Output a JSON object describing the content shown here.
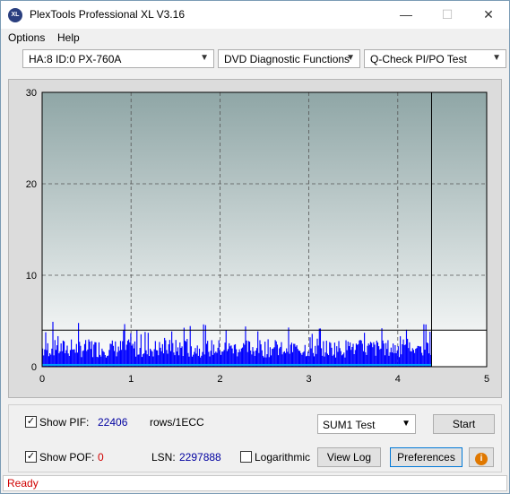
{
  "window": {
    "title": "PlexTools Professional XL V3.16",
    "app_icon": "XL"
  },
  "menu": {
    "options": "Options",
    "help": "Help"
  },
  "toolbar": {
    "drive": "HA:8 ID:0  PX-760A",
    "function": "DVD Diagnostic Functions",
    "test": "Q-Check PI/PO Test"
  },
  "chart_data": {
    "type": "bar",
    "x_ticks": [
      "0",
      "1",
      "2",
      "3",
      "4",
      "5"
    ],
    "y_ticks": [
      "0",
      "10",
      "20",
      "30"
    ],
    "xlim": [
      0,
      5
    ],
    "ylim": [
      0,
      30
    ],
    "grid": true,
    "series": [
      {
        "values_note": "",
        "color": "#0000ff"
      }
    ],
    "pif_typical_range": [
      1,
      3
    ],
    "pif_max": 5,
    "po_level": 0.2,
    "end_x": 4.38,
    "threshold": 4,
    "gradient_top": "#8fa6a6",
    "gradient_bottom": "#ffffff"
  },
  "controls": {
    "show_pif_label": "Show PIF:",
    "pif_value": "22406",
    "pif_unit": "rows/1ECC",
    "show_pof_label": "Show POF:",
    "pof_value": "0",
    "lsn_label": "LSN:",
    "lsn_value": "2297888",
    "log_label": "Logarithmic",
    "test_mode": "SUM1 Test",
    "start": "Start",
    "view_log": "View Log",
    "preferences": "Preferences",
    "pif_checked": true,
    "pof_checked": true,
    "log_checked": false
  },
  "status": {
    "text": "Ready",
    "color": "#d00000"
  },
  "colors": {
    "value_blue": "#0000a0",
    "value_red": "#d00000"
  }
}
